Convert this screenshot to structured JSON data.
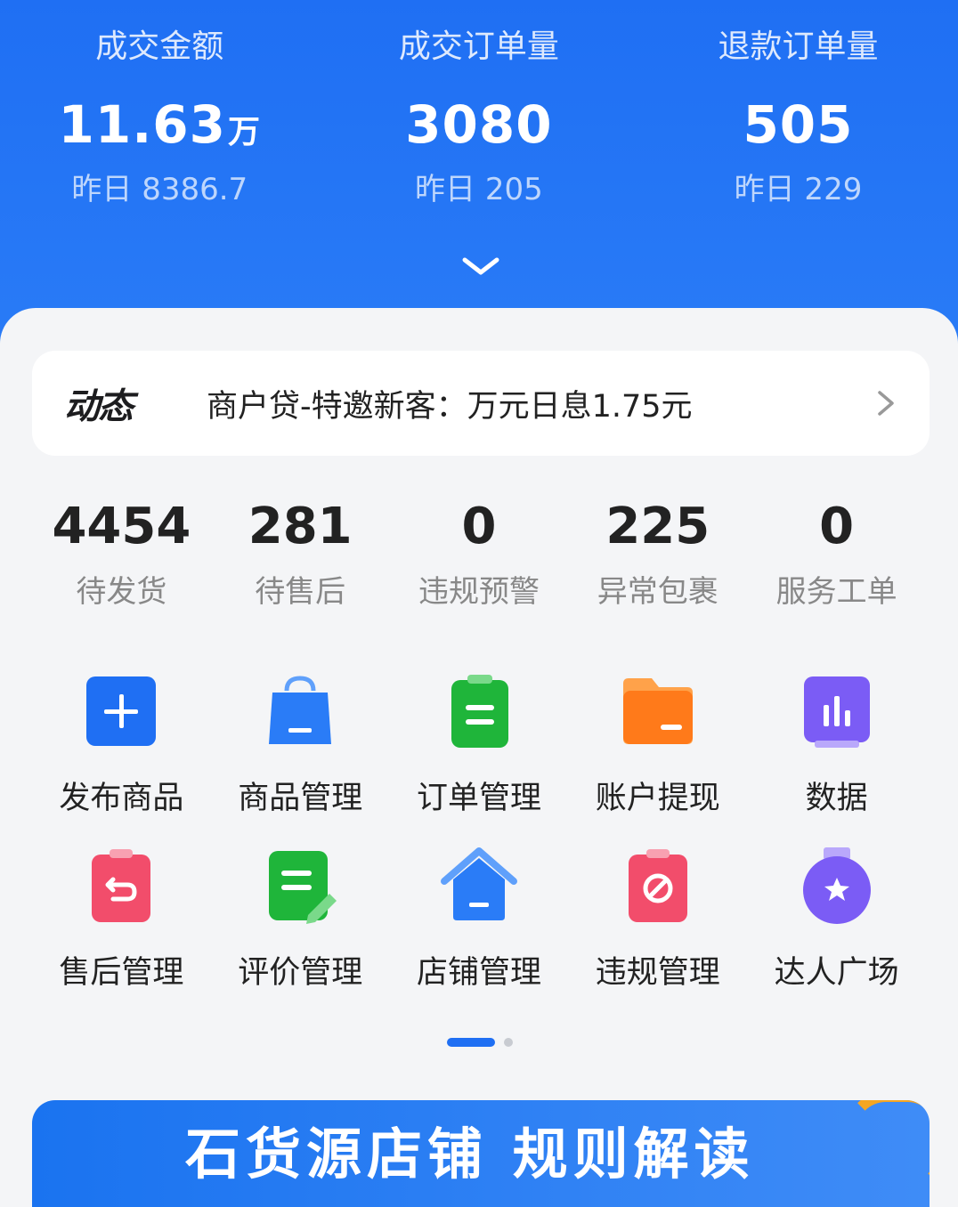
{
  "header": {
    "stats": [
      {
        "label": "成交金额",
        "value": "11.63",
        "unit": "万",
        "yesterday": "昨日 8386.7"
      },
      {
        "label": "成交订单量",
        "value": "3080",
        "unit": "",
        "yesterday": "昨日 205"
      },
      {
        "label": "退款订单量",
        "value": "505",
        "unit": "",
        "yesterday": "昨日 229"
      }
    ]
  },
  "notice": {
    "tag": "动态",
    "text": "商户贷-特邀新客：万元日息1.75元"
  },
  "counts": [
    {
      "value": "4454",
      "label": "待发货"
    },
    {
      "value": "281",
      "label": "待售后"
    },
    {
      "value": "0",
      "label": "违规预警"
    },
    {
      "value": "225",
      "label": "异常包裹"
    },
    {
      "value": "0",
      "label": "服务工单"
    }
  ],
  "tools": [
    {
      "label": "发布商品",
      "icon": "plus-icon",
      "color": "#1f6ff3"
    },
    {
      "label": "商品管理",
      "icon": "shopping-bag-icon",
      "color": "#2a7cf7"
    },
    {
      "label": "订单管理",
      "icon": "clipboard-icon",
      "color": "#1fb53a"
    },
    {
      "label": "账户提现",
      "icon": "wallet-folder-icon",
      "color": "#ff7a1a"
    },
    {
      "label": "数据",
      "icon": "bar-chart-icon",
      "color": "#7b5cf5"
    },
    {
      "label": "售后管理",
      "icon": "return-icon",
      "color": "#f24d6b"
    },
    {
      "label": "评价管理",
      "icon": "review-icon",
      "color": "#1fb53a"
    },
    {
      "label": "店铺管理",
      "icon": "store-home-icon",
      "color": "#2a7cf7"
    },
    {
      "label": "违规管理",
      "icon": "prohibited-icon",
      "color": "#f24d6b"
    },
    {
      "label": "达人广场",
      "icon": "medal-star-icon",
      "color": "#7b5cf5"
    }
  ],
  "banner": {
    "text": "石货源店铺 规则解读"
  }
}
